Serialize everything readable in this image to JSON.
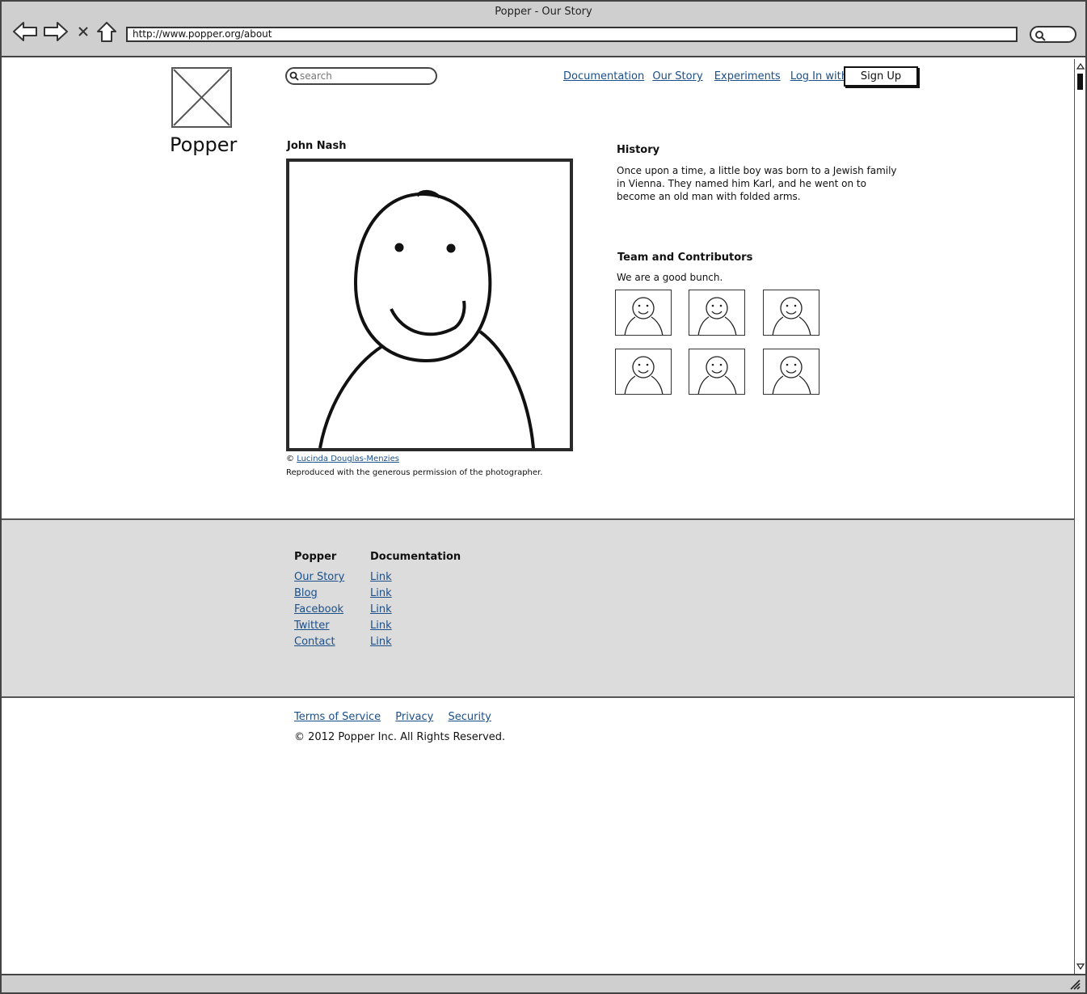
{
  "window": {
    "title": "Popper - Our Story"
  },
  "browser": {
    "url": "http://www.popper.org/about"
  },
  "header": {
    "logo_text": "Popper",
    "search_placeholder": "search",
    "nav": [
      {
        "label": "Documentation"
      },
      {
        "label": "Our Story"
      },
      {
        "label": "Experiments"
      },
      {
        "label": "Log In with GitHub"
      }
    ],
    "signup_label": "Sign Up"
  },
  "profile": {
    "name": "John Nash",
    "credit_prefix": "©",
    "credit_link": "Lucinda Douglas-Menzies",
    "permission": "Reproduced with the generous permission of the photographer."
  },
  "history": {
    "title": "History",
    "text": "Once upon a time, a little boy was born to a Jewish family in Vienna. They named him Karl, and he went on to become an old man with folded arms."
  },
  "team": {
    "title": "Team and Contributors",
    "text": "We are a good bunch."
  },
  "footer": {
    "col1": {
      "title": "Popper",
      "links": [
        "Our Story",
        "Blog",
        "Facebook",
        "Twitter",
        "Contact"
      ]
    },
    "col2": {
      "title": "Documentation",
      "links": [
        "Link",
        "Link",
        "Link",
        "Link",
        "Link"
      ]
    }
  },
  "legal": {
    "links": [
      "Terms of Service",
      "Privacy",
      "Security"
    ],
    "copyright": "© 2012 Popper Inc. All Rights Reserved."
  },
  "colors": {
    "link": "#1a4f8a",
    "footer_bg": "#dcdcdc",
    "chrome_bg": "#cfcfcf"
  }
}
